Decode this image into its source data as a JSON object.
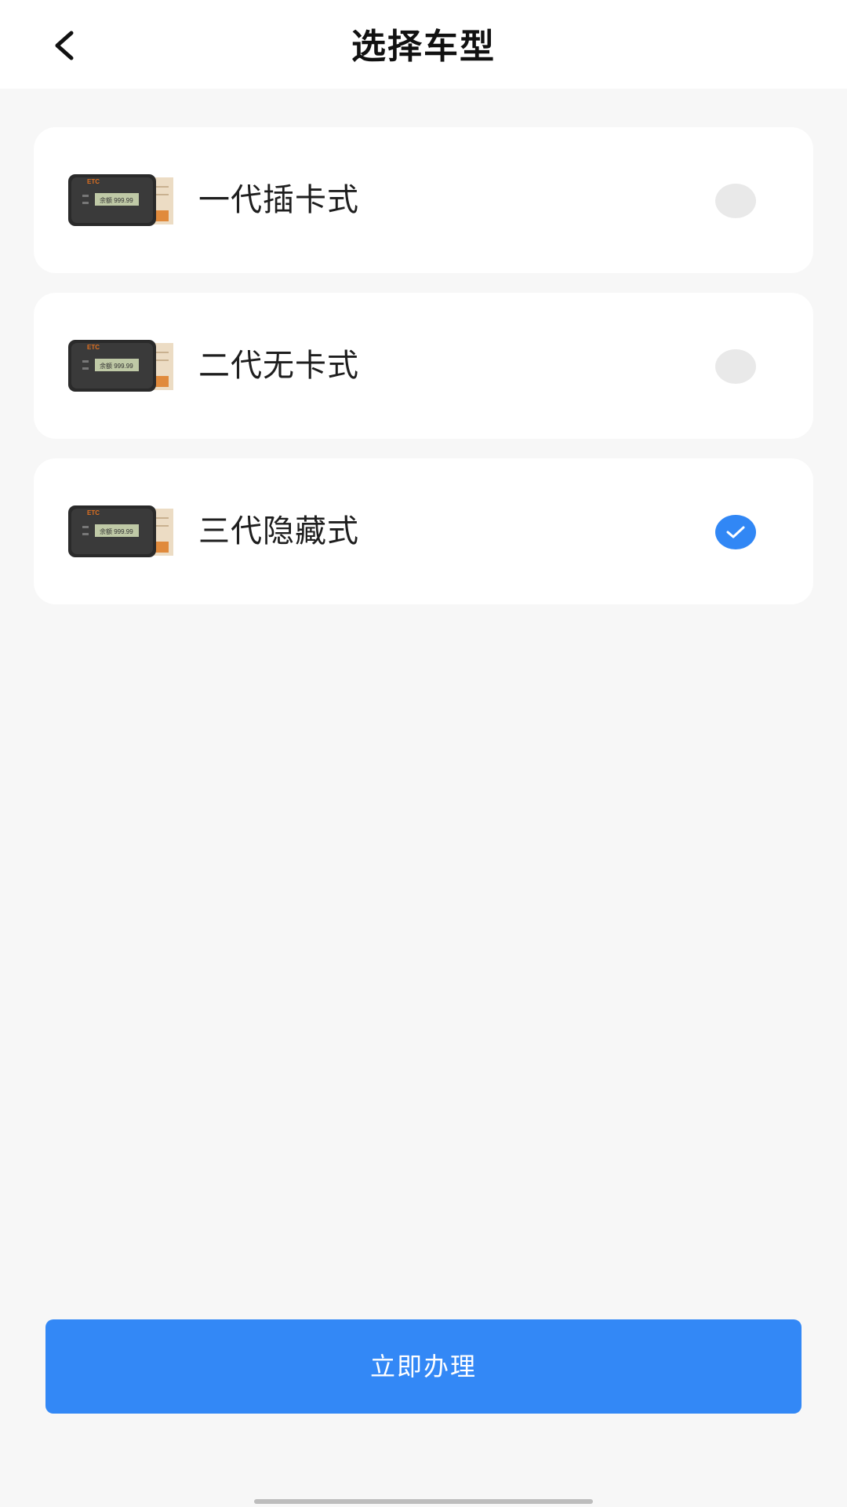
{
  "header": {
    "title": "选择车型",
    "back_icon": "chevron-left-icon"
  },
  "options": [
    {
      "label": "一代插卡式",
      "selected": false,
      "image": "etc-device-thumbnail"
    },
    {
      "label": "二代无卡式",
      "selected": false,
      "image": "etc-device-thumbnail"
    },
    {
      "label": "三代隐藏式",
      "selected": true,
      "image": "etc-device-thumbnail"
    }
  ],
  "device_image": {
    "brand": "ETC",
    "screen_text": "余额 999.99"
  },
  "submit": {
    "label": "立即办理"
  },
  "colors": {
    "accent": "#3388f6",
    "radio_unselected": "#e9e9e9",
    "background": "#f7f7f7"
  }
}
